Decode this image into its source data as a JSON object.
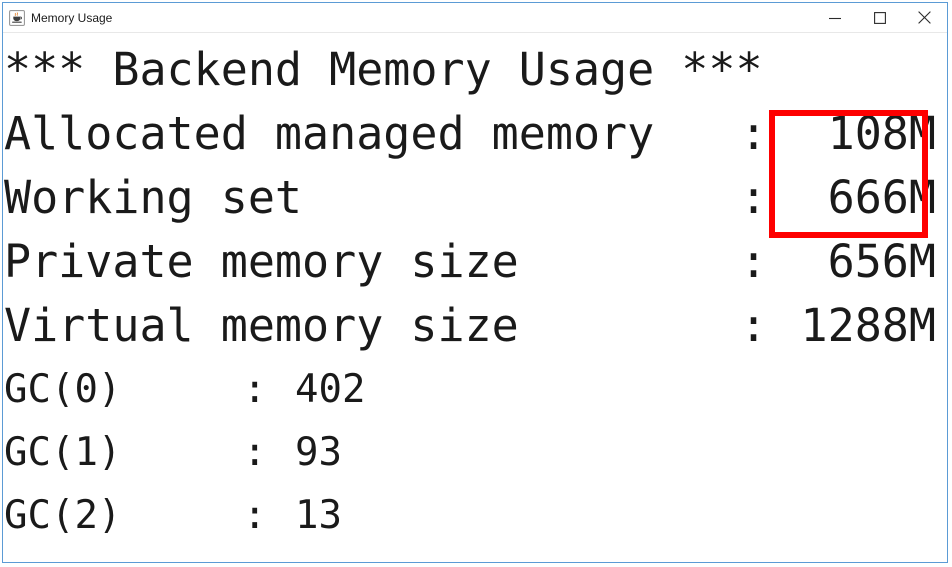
{
  "window": {
    "title": "Memory Usage",
    "icon": "java-coffee-cup-icon",
    "border_color": "#5b9bd5",
    "background": "#ffffff",
    "controls": {
      "minimize_label": "—",
      "maximize_label": "□",
      "close_label": "×",
      "minimize_name": "minimize-button",
      "maximize_name": "maximize-button",
      "close_name": "close-button"
    }
  },
  "console": {
    "heading": "*** Backend Memory Usage ***",
    "separator": ":",
    "rows": [
      {
        "label": "Allocated managed memory",
        "value": "108M",
        "highlighted": true
      },
      {
        "label": "Working set",
        "value": "666M",
        "highlighted": true
      },
      {
        "label": "Private memory size",
        "value": "656M",
        "highlighted": false
      },
      {
        "label": "Virtual memory size",
        "value": "1288M",
        "highlighted": false
      }
    ],
    "gc_rows": [
      {
        "label": "GC(0)",
        "value": "402"
      },
      {
        "label": "GC(1)",
        "value": "93"
      },
      {
        "label": "GC(2)",
        "value": "13"
      }
    ]
  },
  "annotation": {
    "name": "red-highlight-rectangle",
    "color": "#fe0000",
    "stroke_width": "6px",
    "covers": [
      "108M",
      "666M"
    ]
  }
}
